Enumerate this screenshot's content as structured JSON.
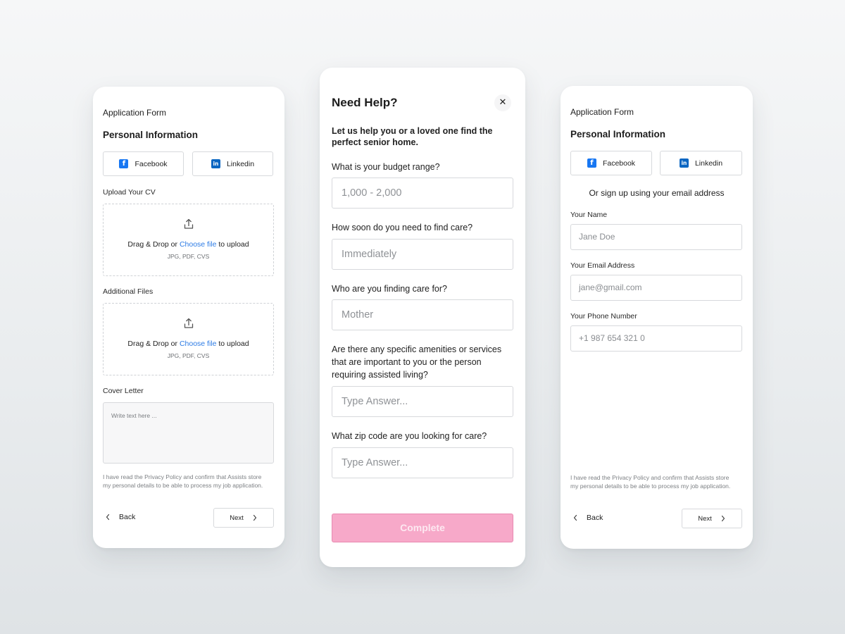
{
  "left_card": {
    "form_title": "Application Form",
    "section_title": "Personal Information",
    "facebook_label": "Facebook",
    "facebook_glyph": "f",
    "linkedin_label": "Linkedin",
    "linkedin_glyph": "in",
    "upload_cv_label": "Upload Your CV",
    "dropzone_text_before": "Drag & Drop or ",
    "dropzone_link": "Choose file",
    "dropzone_text_after": " to upload",
    "dropzone_hint": "JPG, PDF, CVS",
    "additional_files_label": "Additional Files",
    "cover_letter_label": "Cover Letter",
    "cover_letter_placeholder": "Write text here ...",
    "privacy_text": "I have read the Privacy Policy and confirm that Assists store my personal details to be able to process my job application.",
    "back_label": "Back",
    "next_label": "Next"
  },
  "middle_card": {
    "title": "Need Help?",
    "close_glyph": "✕",
    "intro": "Let us help you or a loved one find the perfect senior home.",
    "q_budget": "What is your budget range?",
    "a_budget": "1,000 - 2,000",
    "q_when": "How soon do you need to find care?",
    "a_when": "Immediately",
    "q_who": "Who are you finding care for?",
    "a_who": "Mother",
    "q_amenities": "Are there any specific amenities or services that are important to you or the person requiring assisted living?",
    "a_amenities_placeholder": "Type Answer...",
    "q_zip": "What zip code are you looking for care?",
    "a_zip_placeholder": "Type Answer...",
    "complete_label": "Complete",
    "complete_color": "#f7a9c9"
  },
  "right_card": {
    "form_title": "Application Form",
    "section_title": "Personal Information",
    "facebook_label": "Facebook",
    "facebook_glyph": "f",
    "linkedin_label": "Linkedin",
    "linkedin_glyph": "in",
    "email_signup_text": "Or sign up using your email address",
    "name_label": "Your Name",
    "name_placeholder": "Jane Doe",
    "email_label": "Your Email Address",
    "email_placeholder": "jane@gmail.com",
    "phone_label": "Your Phone Number",
    "phone_placeholder": "+1 987 654 321 0",
    "privacy_text": "I have read the Privacy Policy and confirm that Assists store my personal details to be able to process my job application.",
    "back_label": "Back",
    "next_label": "Next"
  },
  "icons": {
    "upload": "upload-icon",
    "facebook": "facebook-icon",
    "linkedin": "linkedin-icon",
    "close": "close-icon",
    "chevron_left": "chevron-left-icon",
    "chevron_right": "chevron-right-icon"
  },
  "colors": {
    "link": "#2c7be5",
    "facebook": "#1877f2",
    "linkedin": "#0a66c2",
    "complete_button": "#f7a9c9"
  }
}
